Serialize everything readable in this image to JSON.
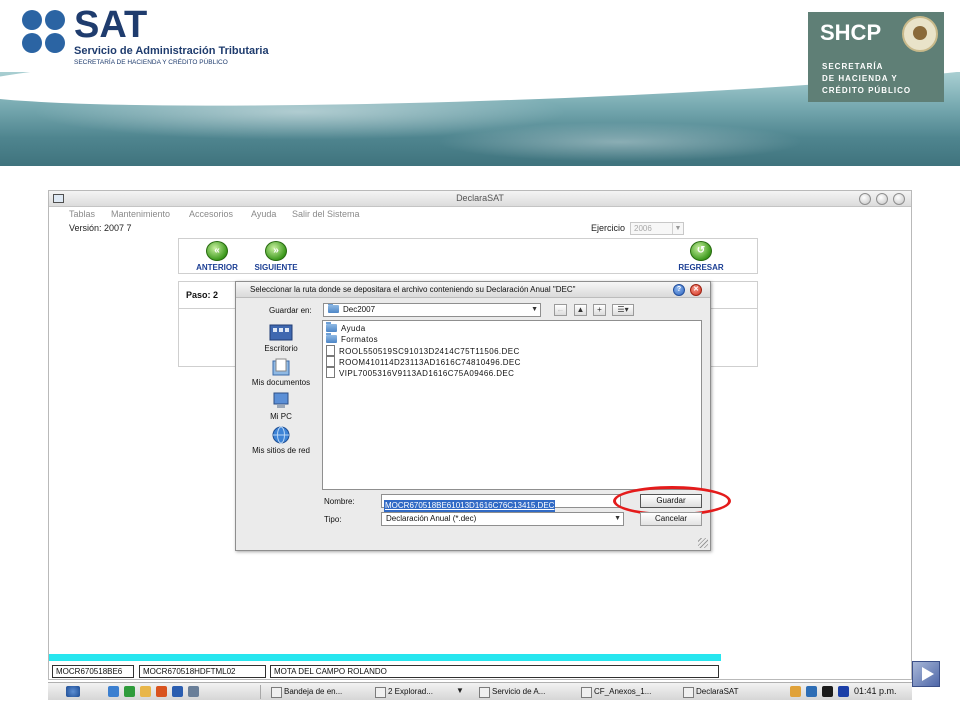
{
  "banner": {
    "sat_word": "SAT",
    "sat_line1": "Servicio de Administración Tributaria",
    "sat_line2": "SECRETARÍA DE HACIENDA Y CRÉDITO PÚBLICO",
    "shcp_word": "SHCP",
    "shcp_lines": [
      "SECRETARÍA",
      "DE HACIENDA Y",
      "CRÉDITO PÚBLICO"
    ]
  },
  "app": {
    "title": "DeclaraSAT",
    "menu": [
      "Tablas",
      "Mantenimiento",
      "Accesorios",
      "Ayuda",
      "Salir del Sistema"
    ],
    "version": "Versión: 2007 7",
    "ejercicio_label": "Ejercicio",
    "ejercicio_value": "2006",
    "nav": {
      "anterior": "ANTERIOR",
      "siguiente": "SIGUIENTE",
      "regresar": "REGRESAR"
    },
    "paso": "Paso: 2",
    "status": [
      "MOCR670518BE6",
      "MOCR670518HDFTML02",
      "MOTA DEL CAMPO ROLANDO"
    ]
  },
  "dialog": {
    "title": "Seleccionar la ruta donde se depositara el archivo conteniendo su Declaración Anual \"DEC\"",
    "guardar_en_label": "Guardar en:",
    "guardar_en_value": "Dec2007",
    "places": [
      "Escritorio",
      "Mis documentos",
      "Mi PC",
      "Mis sitios de red"
    ],
    "folders": [
      "Ayuda",
      "Formatos"
    ],
    "files": [
      "ROOL550519SC91013D2414C75T11506.DEC",
      "ROOM410114D23113AD1616C74810496.DEC",
      "VIPL7005316V9113AD1616C75A09466.DEC"
    ],
    "nombre_label": "Nombre:",
    "nombre_value": "MOCR670518BE61013D1616C76C13415.DEC",
    "tipo_label": "Tipo:",
    "tipo_value": "Declaración Anual (*.dec)",
    "guardar_button": "Guardar",
    "cancelar_button": "Cancelar"
  },
  "taskbar": {
    "tasks": [
      "Bandeja de en...",
      "2 Explorad...",
      "Servicio de A...",
      "CF_Anexos_1...",
      "DeclaraSAT"
    ],
    "time": "01:41 p.m."
  },
  "colors": {
    "sat_blue": "#2b64a3",
    "shcp_green": "#5f7f76",
    "highlight_red": "#e41b1b",
    "status_cyan": "#27e6ef",
    "selection_blue": "#316ac5"
  }
}
